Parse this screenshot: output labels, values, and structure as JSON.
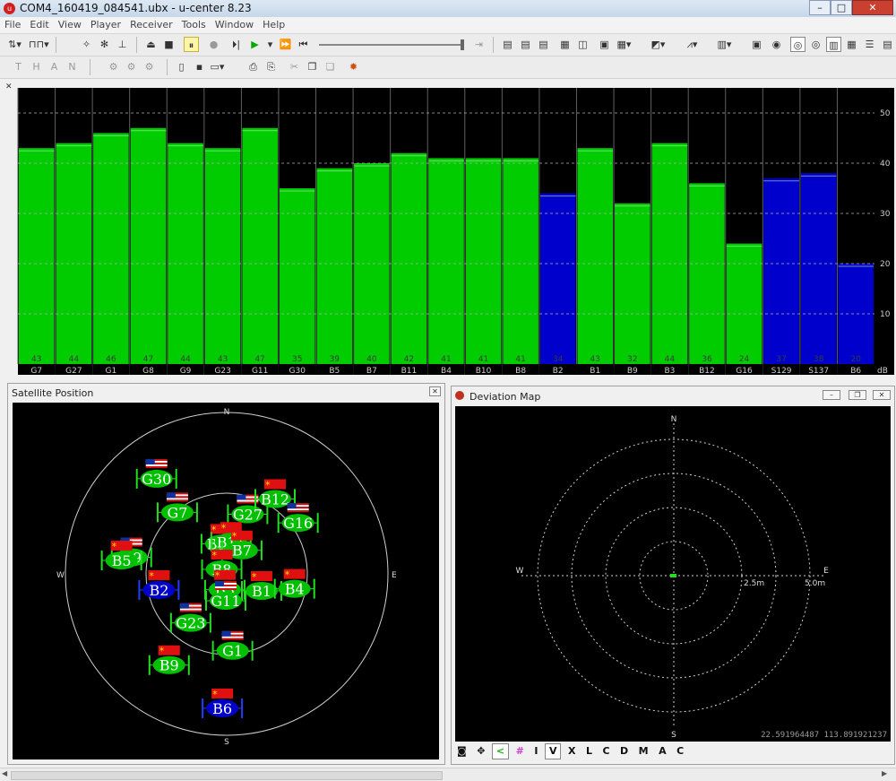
{
  "window": {
    "title": "COM4_160419_084541.ubx - u-center 8.23",
    "app_icon": "u",
    "controls": [
      "minimize-icon",
      "maximize-icon",
      "close-icon"
    ]
  },
  "menu": [
    "File",
    "Edit",
    "View",
    "Player",
    "Receiver",
    "Tools",
    "Window",
    "Help"
  ],
  "toolbar1": {
    "icons": [
      "baud-dropdown-icon",
      "signal-dropdown-icon",
      "connect-wand-icon",
      "receiver-icon",
      "antenna-icon",
      "eject-icon",
      "stop-icon",
      "pause-icon",
      "record-icon",
      "step-icon",
      "play-icon",
      "play-dropdown-icon",
      "fast-forward-icon",
      "rewind-start-icon",
      "slider-end-icon"
    ],
    "view_icons": [
      "doc-a-icon",
      "doc-b-icon",
      "doc-c-icon",
      "table-icon",
      "split-icon",
      "console-icon",
      "grid-icon",
      "grid-dropdown-icon",
      "chart-icon",
      "chart-dropdown-icon",
      "line-chart-icon",
      "line-dropdown-icon",
      "bar-chart-icon",
      "bar-dropdown-icon",
      "monitor-icon",
      "camera-icon",
      "sky-icon",
      "deviation-icon",
      "signal-view-icon",
      "table-view-icon",
      "list-view-icon"
    ]
  },
  "toolbar2": {
    "icons": [
      "text-view-icon",
      "hex-view-icon",
      "ascii-icon",
      "nmea-icon",
      "gear-a-icon",
      "gear-b-icon",
      "gear-c-icon",
      "new-file-icon",
      "save-icon",
      "open-icon",
      "print-icon",
      "print-preview-icon",
      "cut-icon",
      "copy-icon",
      "paste-icon",
      "debug-icon"
    ]
  },
  "colors": {
    "gps_bar": "#00cc00",
    "beidou_bar": "#0000cc",
    "sbas_bar": "#0000cc",
    "chart_bg": "#000000",
    "grid": "#b0b0b0"
  },
  "chart_data": {
    "type": "bar",
    "title": "",
    "ylabel": "dB",
    "ylim": [
      0,
      55
    ],
    "yticks": [
      10,
      20,
      30,
      40,
      50
    ],
    "categories": [
      "G7",
      "G27",
      "G1",
      "G8",
      "G9",
      "G23",
      "G11",
      "G30",
      "B5",
      "B7",
      "B11",
      "B4",
      "B10",
      "B8",
      "B2",
      "B1",
      "B9",
      "B3",
      "B12",
      "G16",
      "S129",
      "S137",
      "B6"
    ],
    "values": [
      43,
      44,
      46,
      47,
      44,
      43,
      47,
      35,
      39,
      40,
      42,
      41,
      41,
      41,
      34,
      43,
      32,
      44,
      36,
      24,
      37,
      38,
      20
    ],
    "series_color": [
      "green",
      "green",
      "green",
      "green",
      "green",
      "green",
      "green",
      "green",
      "green",
      "green",
      "green",
      "green",
      "green",
      "green",
      "blue",
      "green",
      "green",
      "green",
      "green",
      "green",
      "blue",
      "blue",
      "blue"
    ],
    "grid": true
  },
  "satellite_panel": {
    "title": "Satellite Position",
    "compass": [
      "N",
      "E",
      "S",
      "W"
    ],
    "satellites": [
      {
        "id": "G30",
        "flag": "us",
        "color": "green",
        "az": -34,
        "el": 20
      },
      {
        "id": "G7",
        "flag": "us",
        "color": "green",
        "az": -35,
        "el": 42
      },
      {
        "id": "G27",
        "flag": "us",
        "color": "green",
        "az": 17,
        "el": 50
      },
      {
        "id": "B12",
        "flag": "cn",
        "color": "green",
        "az": 30,
        "el": 36
      },
      {
        "id": "G16",
        "flag": "us",
        "color": "green",
        "az": 50,
        "el": 38
      },
      {
        "id": "B10",
        "flag": "cn",
        "color": "green",
        "az": -8,
        "el": 68
      },
      {
        "id": "B11",
        "flag": "cn",
        "color": "green",
        "az": 6,
        "el": 67
      },
      {
        "id": "B7",
        "flag": "cn",
        "color": "green",
        "az": 25,
        "el": 70
      },
      {
        "id": "B8",
        "flag": "cn",
        "color": "green",
        "az": -20,
        "el": 82
      },
      {
        "id": "G9",
        "flag": "us",
        "color": "green",
        "az": -75,
        "el": 35
      },
      {
        "id": "B5",
        "flag": "cn",
        "color": "green",
        "az": -78,
        "el": 30
      },
      {
        "id": "B2",
        "flag": "cn",
        "color": "blue",
        "az": -96,
        "el": 52
      },
      {
        "id": "B3",
        "flag": "cn",
        "color": "green",
        "az": -165,
        "el": 86
      },
      {
        "id": "B1",
        "flag": "cn",
        "color": "green",
        "az": 103,
        "el": 70
      },
      {
        "id": "B4",
        "flag": "cn",
        "color": "green",
        "az": 95,
        "el": 52
      },
      {
        "id": "G11",
        "flag": "us",
        "color": "green",
        "az": -177,
        "el": 80
      },
      {
        "id": "G23",
        "flag": "us",
        "color": "green",
        "az": -138,
        "el": 60
      },
      {
        "id": "G1",
        "flag": "us",
        "color": "green",
        "az": 175,
        "el": 52
      },
      {
        "id": "B9",
        "flag": "cn",
        "color": "green",
        "az": -145,
        "el": 34
      },
      {
        "id": "B6",
        "flag": "cn",
        "color": "blue",
        "az": -178,
        "el": 20
      }
    ]
  },
  "deviation_panel": {
    "title": "Deviation Map",
    "compass": [
      "N",
      "E",
      "S",
      "W"
    ],
    "ring_labels": [
      "2.5m",
      "5.0m"
    ],
    "coordinates": "22.591964487 113.891921237",
    "toolbar": [
      "camera-icon",
      "move-icon",
      "curve-icon",
      "grid-icon"
    ],
    "modes": [
      "I",
      "V",
      "X",
      "L",
      "C",
      "D",
      "M",
      "A",
      "C"
    ],
    "selected_mode": "V"
  }
}
